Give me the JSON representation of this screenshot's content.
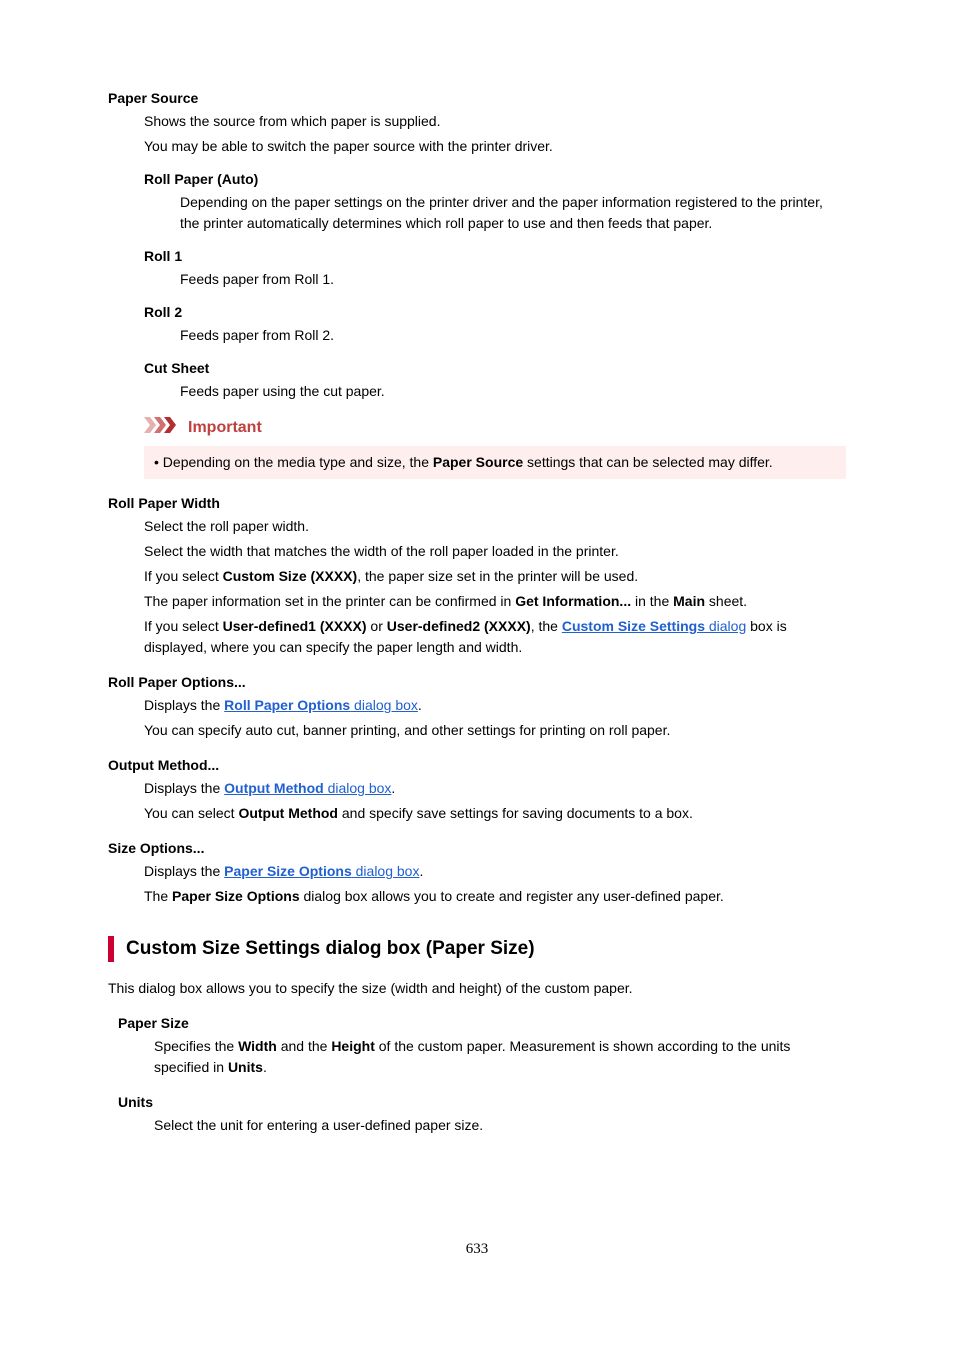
{
  "paperSource": {
    "heading": "Paper Source",
    "line1": "Shows the source from which paper is supplied.",
    "line2": "You may be able to switch the paper source with the printer driver.",
    "rollAuto": {
      "heading": "Roll Paper (Auto)",
      "desc": "Depending on the paper settings on the printer driver and the paper information registered to the printer, the printer automatically determines which roll paper to use and then feeds that paper."
    },
    "roll1": {
      "heading": "Roll 1",
      "desc": "Feeds paper from Roll 1."
    },
    "roll2": {
      "heading": "Roll 2",
      "desc": "Feeds paper from Roll 2."
    },
    "cutSheet": {
      "heading": "Cut Sheet",
      "desc": "Feeds paper using the cut paper."
    },
    "important": {
      "title": "Important",
      "bullet": "• ",
      "text1": "Depending on the media type and size, the ",
      "bold": "Paper Source",
      "text2": " settings that can be selected may differ."
    }
  },
  "rollPaperWidth": {
    "heading": "Roll Paper Width",
    "l1": "Select the roll paper width.",
    "l2": "Select the width that matches the width of the roll paper loaded in the printer.",
    "l3a": "If you select ",
    "l3b": "Custom Size (XXXX)",
    "l3c": ", the paper size set in the printer will be used.",
    "l4a": "The paper information set in the printer can be confirmed in ",
    "l4b": "Get Information...",
    "l4c": " in the ",
    "l4d": "Main",
    "l4e": " sheet.",
    "l5a": "If you select ",
    "l5b": "User-defined1 (XXXX)",
    "l5c": " or ",
    "l5d": "User-defined2 (XXXX)",
    "l5e": ", the ",
    "l5link1": "Custom Size Settings",
    "l5link2": " dialog",
    "l5f": " box is displayed, where you can specify the paper length and width."
  },
  "rollPaperOptions": {
    "heading": "Roll Paper Options...",
    "l1a": "Displays the ",
    "l1link1": "Roll Paper Options",
    "l1link2": " dialog box",
    "l1b": ".",
    "l2": "You can specify auto cut, banner printing, and other settings for printing on roll paper."
  },
  "outputMethod": {
    "heading": "Output Method...",
    "l1a": "Displays the ",
    "l1link1": "Output Method",
    "l1link2": " dialog box",
    "l1b": ".",
    "l2a": "You can select ",
    "l2b": "Output Method",
    "l2c": " and specify save settings for saving documents to a box."
  },
  "sizeOptions": {
    "heading": "Size Options...",
    "l1a": "Displays the ",
    "l1link1": "Paper Size Options",
    "l1link2": " dialog box",
    "l1b": ".",
    "l2a": "The ",
    "l2b": "Paper Size Options",
    "l2c": " dialog box allows you to create and register any user-defined paper."
  },
  "customSection": {
    "heading": "Custom Size Settings dialog box (Paper Size)",
    "intro": "This dialog box allows you to specify the size (width and height) of the custom paper.",
    "paperSize": {
      "heading": "Paper Size",
      "t1": "Specifies the ",
      "t2": "Width",
      "t3": " and the ",
      "t4": "Height",
      "t5": " of the custom paper. Measurement is shown according to the units specified in ",
      "t6": "Units",
      "t7": "."
    },
    "units": {
      "heading": "Units",
      "desc": "Select the unit for entering a user-defined paper size."
    }
  },
  "pageNum": "633"
}
